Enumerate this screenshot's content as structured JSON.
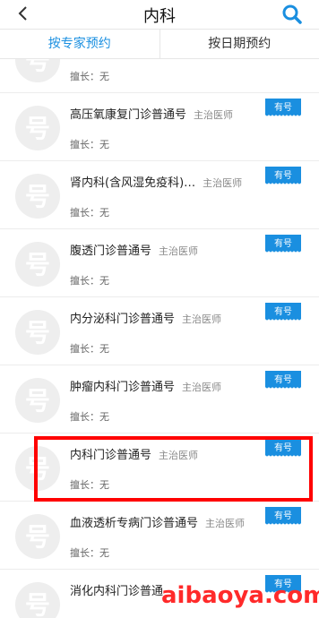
{
  "header": {
    "title": "内科",
    "back_icon": "back-chevron-icon",
    "search_icon": "search-icon",
    "accent_color": "#1a8fe0"
  },
  "tabs": [
    {
      "label": "按专家预约",
      "active": true
    },
    {
      "label": "按日期预约",
      "active": false
    }
  ],
  "avatar_glyph": "号",
  "items": [
    {
      "name": "",
      "rank": "",
      "skill": "擅长：无",
      "badge": "",
      "partial": true
    },
    {
      "name": "高压氧康复门诊普通号",
      "rank": "主治医师",
      "skill": "擅长：无",
      "badge": "有号"
    },
    {
      "name": "肾内科(含风湿免疫科)…",
      "rank": "主治医师",
      "skill": "擅长：无",
      "badge": "有号"
    },
    {
      "name": "腹透门诊普通号",
      "rank": "主治医师",
      "skill": "擅长：无",
      "badge": "有号"
    },
    {
      "name": "内分泌科门诊普通号",
      "rank": "主治医师",
      "skill": "擅长：无",
      "badge": "有号"
    },
    {
      "name": "肿瘤内科门诊普通号",
      "rank": "主治医师",
      "skill": "擅长：无",
      "badge": "有号"
    },
    {
      "name": "内科门诊普通号",
      "rank": "主治医师",
      "skill": "擅长：无",
      "badge": "有号"
    },
    {
      "name": "血液透析专病门诊普通号",
      "rank": "主治医师",
      "skill": "擅长：无",
      "badge": "有号"
    },
    {
      "name": "消化内科门诊普通",
      "rank": "",
      "skill": "",
      "badge": "有号"
    }
  ],
  "watermark": "aibaoya.com",
  "highlight_color": "#ff0000"
}
